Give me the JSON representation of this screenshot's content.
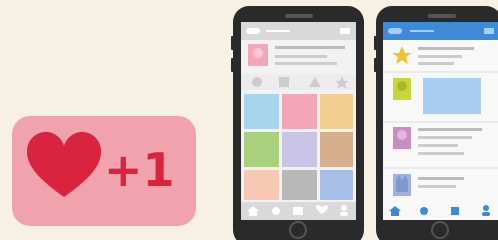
{
  "like_badge": {
    "text": "+1"
  },
  "colors": {
    "background": "#f7f1e3",
    "badge": "#f0a3ac",
    "heart": "#d8243f",
    "plus_one": "#d8243f",
    "phone_body": "#2a2a2a",
    "screen": "#f2f2f2",
    "header_gray": "#d9d9d9",
    "header_blue": "#3d8ad8",
    "tabbar_blue": "#3d8ad8",
    "tile_colors": [
      "#a9d5ec",
      "#f3a6b8",
      "#f1d08f",
      "#a8d07e",
      "#c9c3e6",
      "#d6b08c",
      "#f7c9b5",
      "#b8b8b8",
      "#a7c0ea"
    ]
  },
  "phones": [
    {
      "name": "gallery-phone",
      "header_style": "gray",
      "tabbar_style": "gray"
    },
    {
      "name": "timeline-phone",
      "header_style": "blue",
      "tabbar_style": "blue",
      "avatars": [
        "star",
        "person-green",
        "person-pink",
        "cat"
      ]
    }
  ]
}
